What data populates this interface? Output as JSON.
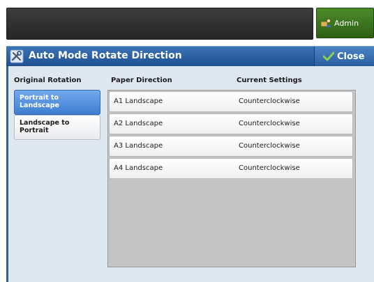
{
  "header": {
    "admin_label": "Admin"
  },
  "titlebar": {
    "title": "Auto Mode Rotate Direction",
    "close_label": "Close"
  },
  "columns": {
    "original_rotation": "Original Rotation",
    "paper_direction": "Paper Direction",
    "current_settings": "Current Settings"
  },
  "rotation_options": [
    {
      "label_line1": "Portrait to",
      "label_line2": "Landscape",
      "selected": true
    },
    {
      "label_line1": "Landscape to",
      "label_line2": "Portrait",
      "selected": false
    }
  ],
  "rows": [
    {
      "paper_direction": "A1 Landscape",
      "current_setting": "Counterclockwise"
    },
    {
      "paper_direction": "A2 Landscape",
      "current_setting": "Counterclockwise"
    },
    {
      "paper_direction": "A3 Landscape",
      "current_setting": "Counterclockwise"
    },
    {
      "paper_direction": "A4 Landscape",
      "current_setting": "Counterclockwise"
    }
  ],
  "colors": {
    "title_blue": "#2a5d9f",
    "selected_blue": "#4a88d8",
    "admin_green": "#3d7520"
  },
  "icons": {
    "admin": "admin-user-icon",
    "title": "tools-icon",
    "close": "checkmark-icon"
  }
}
